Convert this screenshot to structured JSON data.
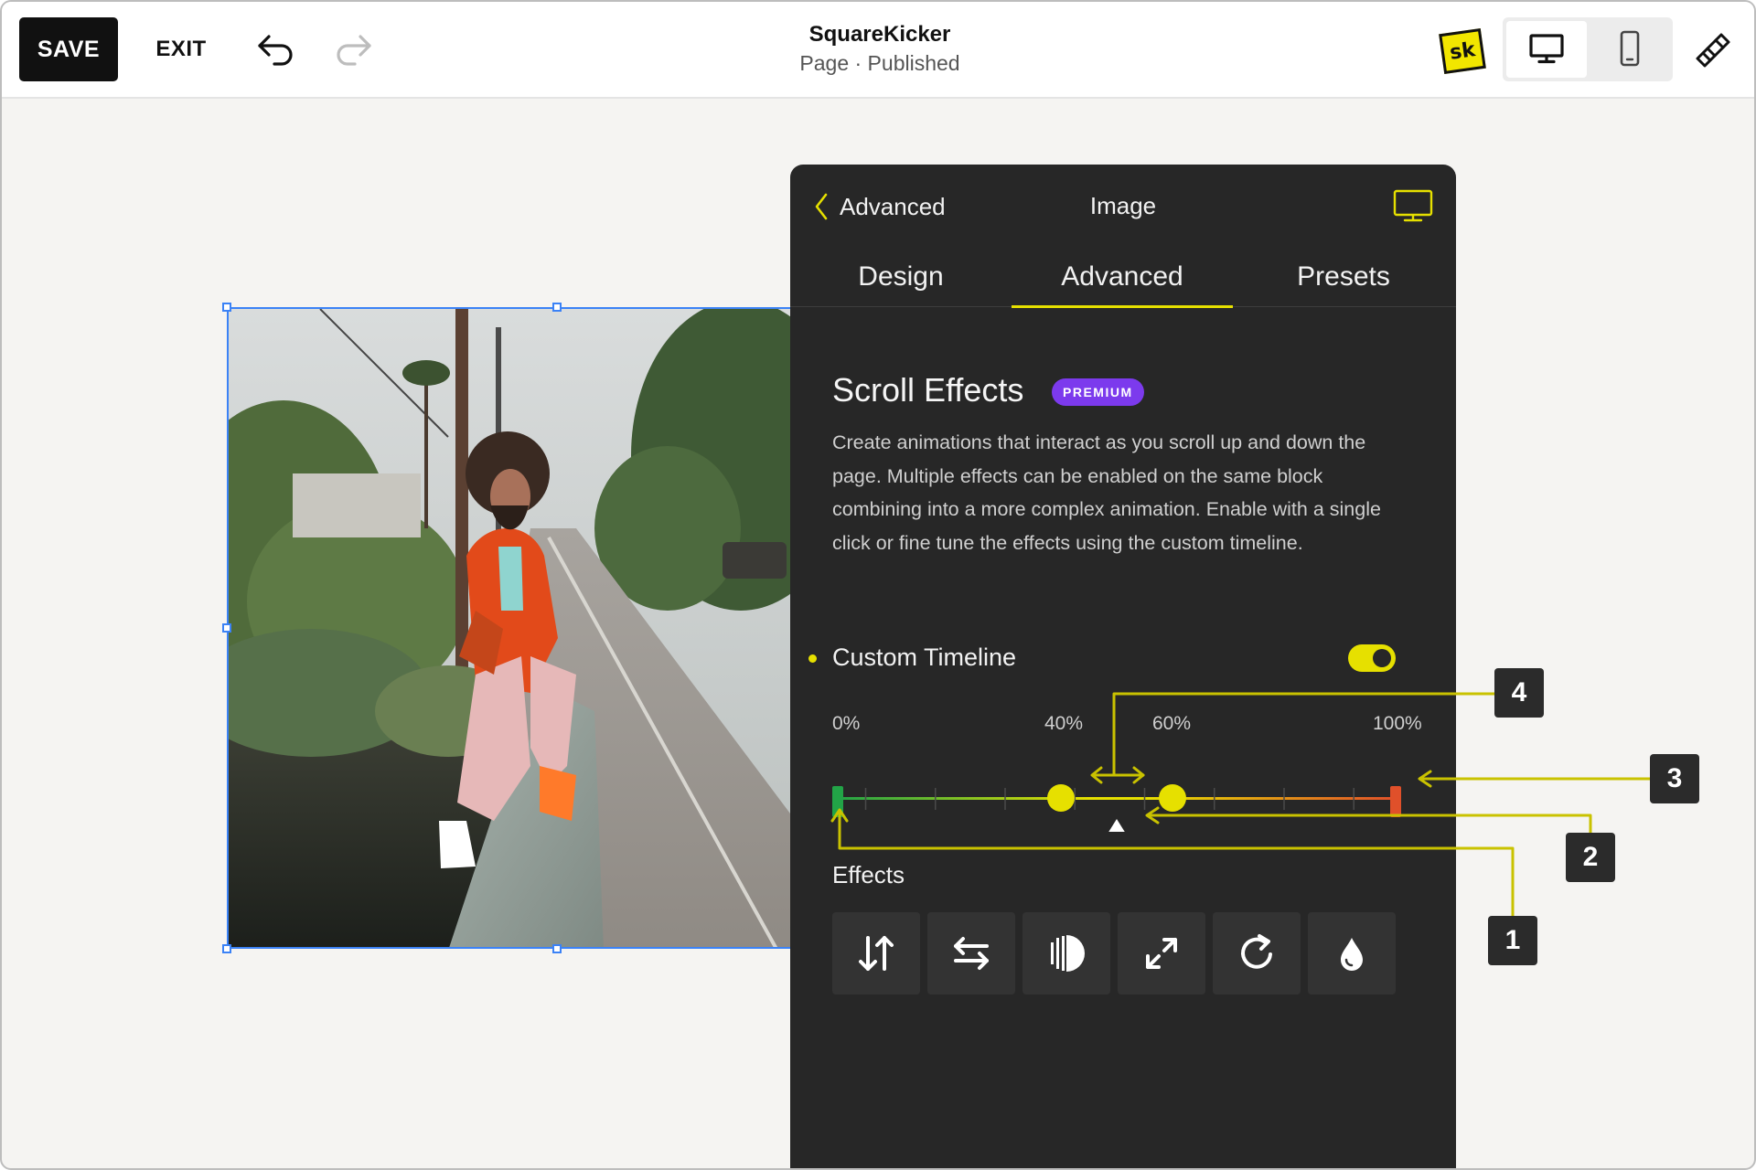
{
  "header": {
    "save_label": "SAVE",
    "exit_label": "EXIT",
    "site_title": "SquareKicker",
    "page_status": "Page · Published",
    "logo_text": "sk"
  },
  "panel": {
    "back_label": "Advanced",
    "title": "Image",
    "tabs": [
      {
        "label": "Design"
      },
      {
        "label": "Advanced",
        "active": true
      },
      {
        "label": "Presets"
      }
    ],
    "section_title": "Scroll Effects",
    "badge": "PREMIUM",
    "description": "Create animations that interact as you scroll up and down the page. Multiple effects can be enabled on the same block combining into a more complex animation. Enable with a single click or fine tune the effects using the custom timeline.",
    "custom_timeline_label": "Custom Timeline",
    "custom_timeline_enabled": true,
    "timeline": {
      "labels": [
        "0%",
        "40%",
        "60%",
        "100%"
      ],
      "start": 0,
      "handle_a": 40,
      "handle_b": 60,
      "end": 100,
      "marker": 50
    },
    "effects_label": "Effects",
    "effects": [
      {
        "icon": "vertical-move-icon"
      },
      {
        "icon": "horizontal-move-icon"
      },
      {
        "icon": "opacity-icon"
      },
      {
        "icon": "scale-icon"
      },
      {
        "icon": "rotate-icon"
      },
      {
        "icon": "blur-icon"
      }
    ]
  },
  "callouts": [
    "1",
    "2",
    "3",
    "4"
  ],
  "colors": {
    "accent": "#e6e000",
    "panel_bg": "#272727",
    "badge": "#7c3aed",
    "selection": "#3b82f6",
    "timeline_start": "#22a447",
    "timeline_end": "#e0502a"
  }
}
